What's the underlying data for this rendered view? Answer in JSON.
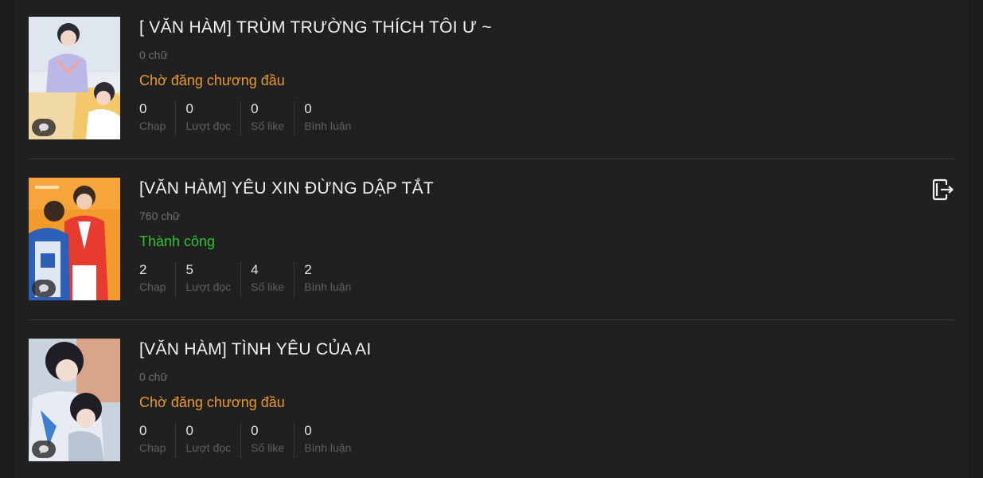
{
  "colors": {
    "pending": "#e89a2c",
    "success": "#2fc12f"
  },
  "stat_labels": {
    "chap": "Chap",
    "reads": "Lượt đọc",
    "likes": "Số like",
    "comments": "Bình luận"
  },
  "stories": [
    {
      "title": "[ VĂN HÀM] TRÙM TRƯỜNG THÍCH TÔI Ư ~",
      "words": "0 chữ",
      "status": "Chờ đăng chương đầu",
      "status_type": "pending",
      "chap": "0",
      "reads": "0",
      "likes": "0",
      "comments": "0",
      "cover_icon": "comment-icon"
    },
    {
      "title": "[VĂN HÀM] YÊU XIN ĐỪNG DẬP TẮT",
      "words": "760 chữ",
      "status": "Thành công",
      "status_type": "success",
      "chap": "2",
      "reads": "5",
      "likes": "4",
      "comments": "2",
      "cover_icon": "comment-icon",
      "action_icon": "export-icon"
    },
    {
      "title": "[VĂN HÀM] TÌNH YÊU CỦA AI",
      "words": "0 chữ",
      "status": "Chờ đăng chương đầu",
      "status_type": "pending",
      "chap": "0",
      "reads": "0",
      "likes": "0",
      "comments": "0",
      "cover_icon": "comment-icon"
    }
  ]
}
